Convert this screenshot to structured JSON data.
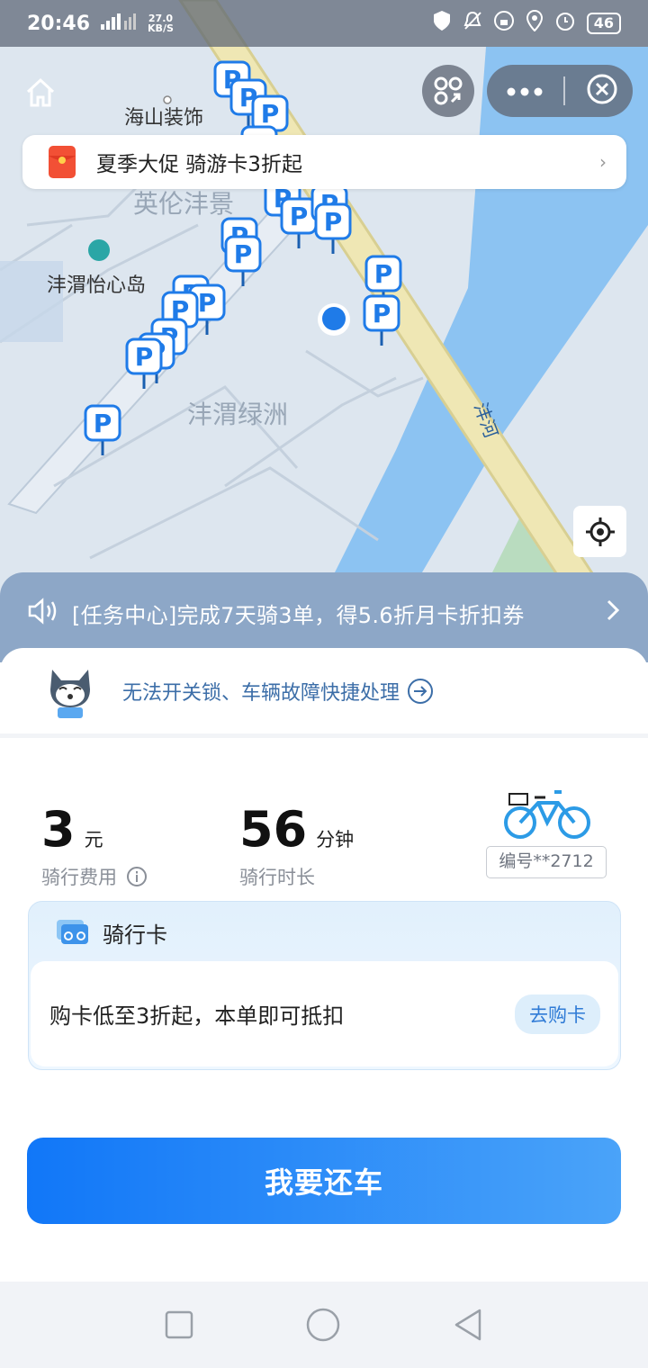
{
  "status_bar": {
    "time": "20:46",
    "net_speed": "27.0",
    "net_unit": "KB/S",
    "battery": "46"
  },
  "map": {
    "labels": [
      "海山装饰",
      "英伦沣景",
      "沣渭怡心岛",
      "沣渭绿洲",
      "沣河"
    ],
    "parking_icon": "P"
  },
  "promo": {
    "text": "夏季大促 骑游卡3折起"
  },
  "notice": {
    "text": "[任务中心]完成7天骑3单，得5.6折月卡折扣券"
  },
  "helper": {
    "text": "无法开关锁、车辆故障快捷处理"
  },
  "stats": {
    "fee_value": "3",
    "fee_unit": "元",
    "fee_label": "骑行费用",
    "duration_value": "56",
    "duration_unit": "分钟",
    "duration_label": "骑行时长",
    "bike_id": "编号**2712"
  },
  "ride_card": {
    "title": "骑行卡",
    "offer": "购卡低至3折起，本单即可抵扣",
    "buy_label": "去购卡"
  },
  "return_button": "我要还车",
  "colors": {
    "accent": "#1177f8",
    "notice_bg": "#8da7c7",
    "river": "#8cc3f2"
  }
}
